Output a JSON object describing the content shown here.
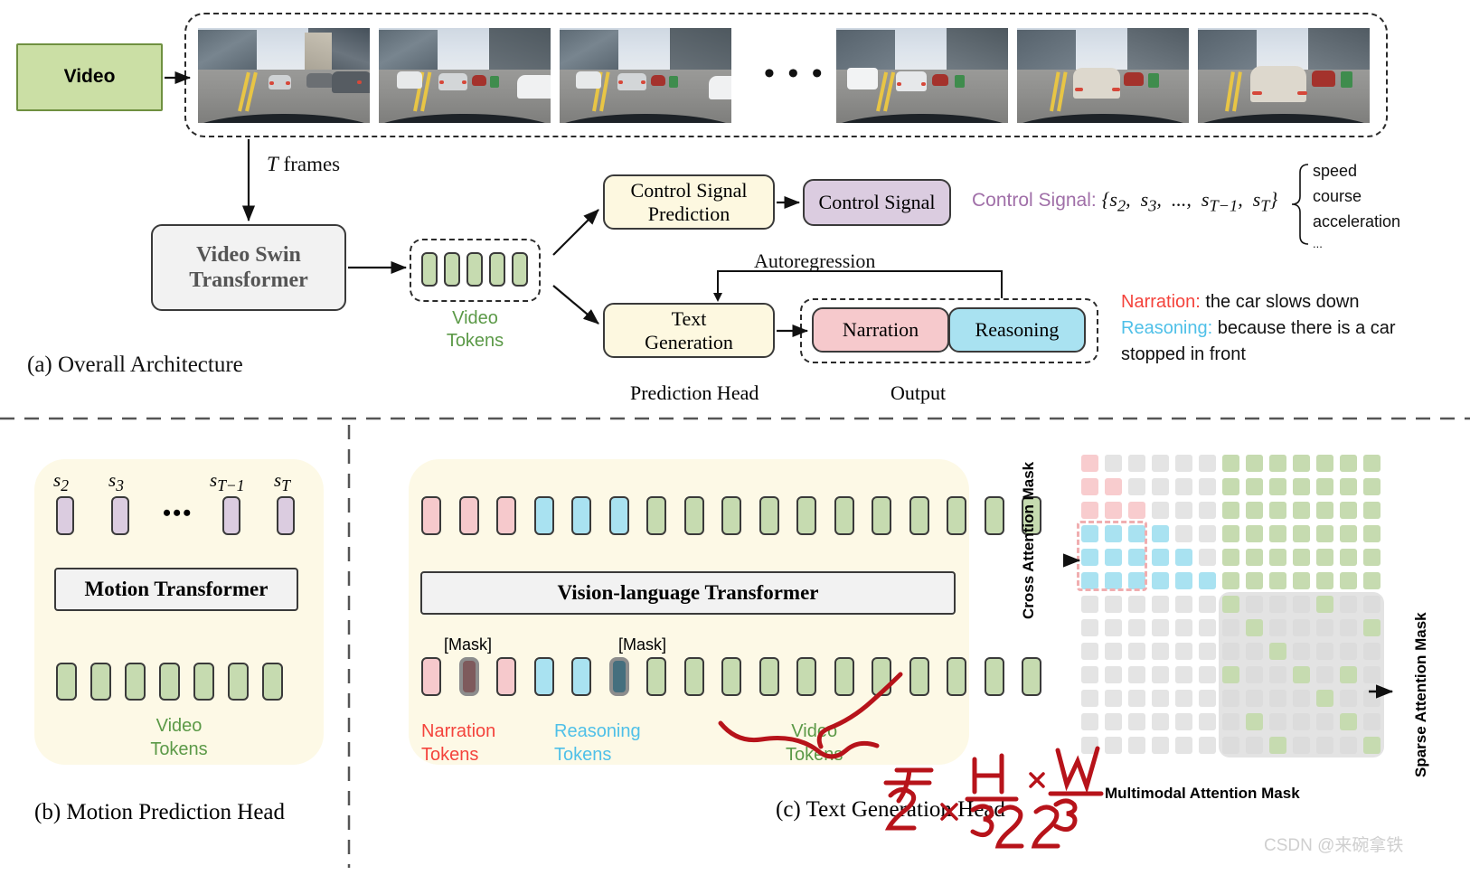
{
  "figure": {
    "panel_a_caption": "(a) Overall Architecture",
    "panel_b_caption": "(b) Motion Prediction Head",
    "panel_c_caption": "(c) Text Generation Head",
    "watermark": "CSDN @来碗拿铁"
  },
  "panel_a": {
    "video_box_label": "Video",
    "frames_ellipsis": "•  •  •",
    "t_frames_label_italic": "T",
    "t_frames_label_rest": " frames",
    "backbone_line1": "Video Swin",
    "backbone_line2": "Transformer",
    "video_tokens_line1": "Video",
    "video_tokens_line2": "Tokens",
    "control_pred_line1": "Control Signal",
    "control_pred_line2": "Prediction",
    "control_signal_box": "Control Signal",
    "autoregression_label": "Autoregression",
    "text_gen_line1": "Text",
    "text_gen_line2": "Generation",
    "output_narration": "Narration",
    "output_reasoning": "Reasoning",
    "prediction_head_label": "Prediction Head",
    "output_label": "Output",
    "control_signal_formula_prefix": "Control Signal:",
    "control_signal_set": "{s₂,  s₃,  ...,  s_{T−1},  s_T}",
    "signal_items": [
      "speed",
      "course",
      "acceleration",
      "..."
    ],
    "narration_key": "Narration:",
    "narration_text": "the car slows down",
    "reasoning_key": "Reasoning:",
    "reasoning_text_line1": "because there is a car",
    "reasoning_text_line2": "stopped in front"
  },
  "panel_b": {
    "signal_labels": [
      "s₂",
      "s₃",
      "s_{T−1}",
      "s_T"
    ],
    "ellipsis": "•••",
    "transformer_label": "Motion Transformer",
    "video_tokens_line1": "Video",
    "video_tokens_line2": "Tokens",
    "num_video_tokens": 7,
    "num_signal_tokens": 4
  },
  "panel_c": {
    "transformer_label": "Vision-language Transformer",
    "mask_label_1": "[Mask]",
    "mask_label_2": "[Mask]",
    "narration_tokens_line1": "Narration",
    "narration_tokens_line2": "Tokens",
    "reasoning_tokens_line1": "Reasoning",
    "reasoning_tokens_line2": "Tokens",
    "video_tokens_line1": "Video",
    "video_tokens_line2": "Tokens",
    "token_sequence_top": [
      "pink",
      "pink",
      "pink",
      "blue",
      "blue",
      "blue",
      "green",
      "green",
      "green",
      "green",
      "green",
      "green",
      "green",
      "green",
      "green",
      "green",
      "green"
    ],
    "token_sequence_bottom": [
      "pink",
      "mask-pink",
      "pink",
      "blue",
      "blue",
      "mask-blue",
      "green",
      "green",
      "green",
      "green",
      "green",
      "green",
      "green",
      "green",
      "green",
      "green",
      "green"
    ],
    "handwriting": "T/2 × H/32 × W/32"
  },
  "mask_panel": {
    "cross_attention_label": "Cross Attention Mask",
    "sparse_attention_label": "Sparse Attention Mask",
    "multimodal_label": "Multimodal Attention Mask",
    "grid_rows": 13,
    "grid_cols": 13,
    "text_block_cols": 6,
    "video_block_cols": 7,
    "narration_rows": 3,
    "reasoning_rows": 3,
    "sparse_highlight_cells": [
      [
        0,
        0
      ],
      [
        0,
        4
      ],
      [
        1,
        1
      ],
      [
        1,
        6
      ],
      [
        2,
        2
      ],
      [
        3,
        0
      ],
      [
        3,
        3
      ],
      [
        3,
        5
      ],
      [
        4,
        4
      ],
      [
        5,
        1
      ],
      [
        5,
        5
      ],
      [
        6,
        2
      ],
      [
        6,
        6
      ]
    ]
  },
  "colors": {
    "green_token": "#c6dbb0",
    "pink_token": "#f6c9cc",
    "blue_token": "#a9e2f1",
    "purple_token": "#dbcce0",
    "cream_panel": "#fdf9e6",
    "cream_box": "#fdf8e0",
    "grey_box": "#f2f2f2",
    "grey_cell": "#e4e4e4",
    "control_signal_purple": "#a06fa8",
    "narration_red": "#f4433c",
    "reasoning_blue": "#4fc0e8",
    "video_green": "#5b9947",
    "mask_green": "#c6dbb0",
    "mask_pink": "#f8ccce",
    "mask_blue": "#a9e2f1",
    "handwriting_red": "#b7131a",
    "border_dark": "#3a3a3a"
  }
}
